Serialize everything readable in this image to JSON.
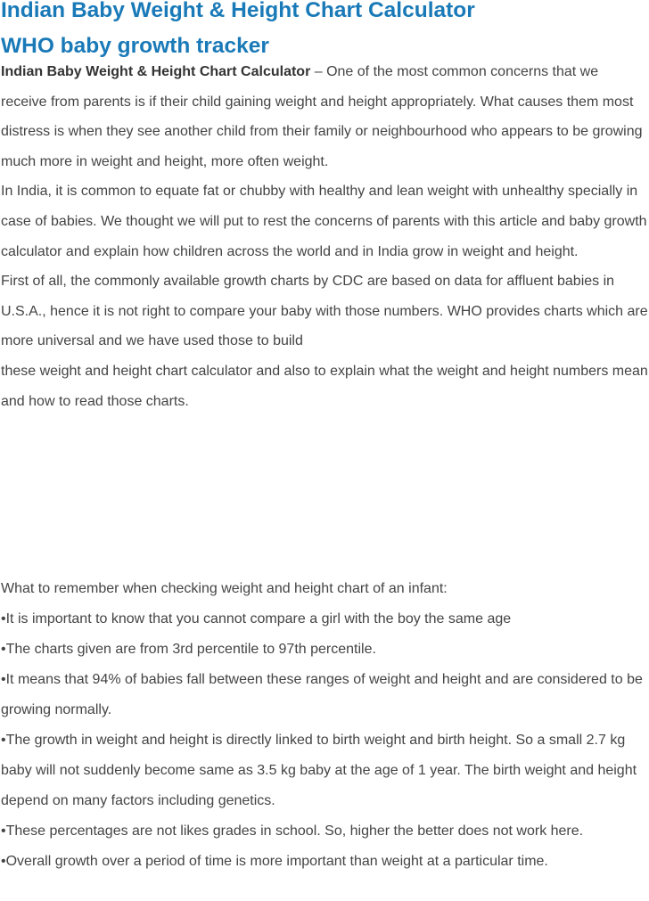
{
  "header": {
    "title_line1": "Indian Baby Weight & Height Chart Calculator",
    "title_line2": "WHO baby growth tracker"
  },
  "intro": {
    "lead": "Indian Baby Weight & Height Chart Calculator",
    "p1_rest": " – One of the most common concerns that we receive from parents is if their child gaining weight and height appropriately. What causes them most distress is when they see another child from their family or neighbourhood who appears to be growing much more in weight and height, more often weight.",
    "p2": "In India, it is common to equate fat or chubby with healthy and lean weight with unhealthy specially in case of babies. We thought we will put to rest the concerns of parents with this article and baby growth calculator and explain how children across the world and in India grow in weight and height.",
    "p3_a": "First of all, the commonly available growth charts by CDC are based on data for affluent babies in U.S.A., hence it is not right to compare your baby with those numbers. WHO provides charts which are more universal and we have used those to build",
    "p3_b": "these weight and height chart calculator and also to explain what the weight and height numbers mean and how to read those charts."
  },
  "remember": {
    "heading": "What to remember when checking weight and height chart of an infant:",
    "bullet_symbol": "•",
    "items": [
      "It is important to know that you cannot compare a girl with the boy the same age",
      "The charts given are from 3rd percentile to 97th percentile.",
      "It means that 94% of babies fall between these ranges of weight and height and are considered to be growing normally.",
      "The growth in weight and height is directly linked to birth weight and birth height. So a small 2.7 kg baby will not suddenly become same as 3.5 kg baby at the age of 1 year. The birth weight and height depend on many factors including genetics.",
      "These percentages are not likes grades in school. So, higher the better does not work here.",
      "Overall growth over a period of time is more important than weight at a particular time."
    ]
  }
}
